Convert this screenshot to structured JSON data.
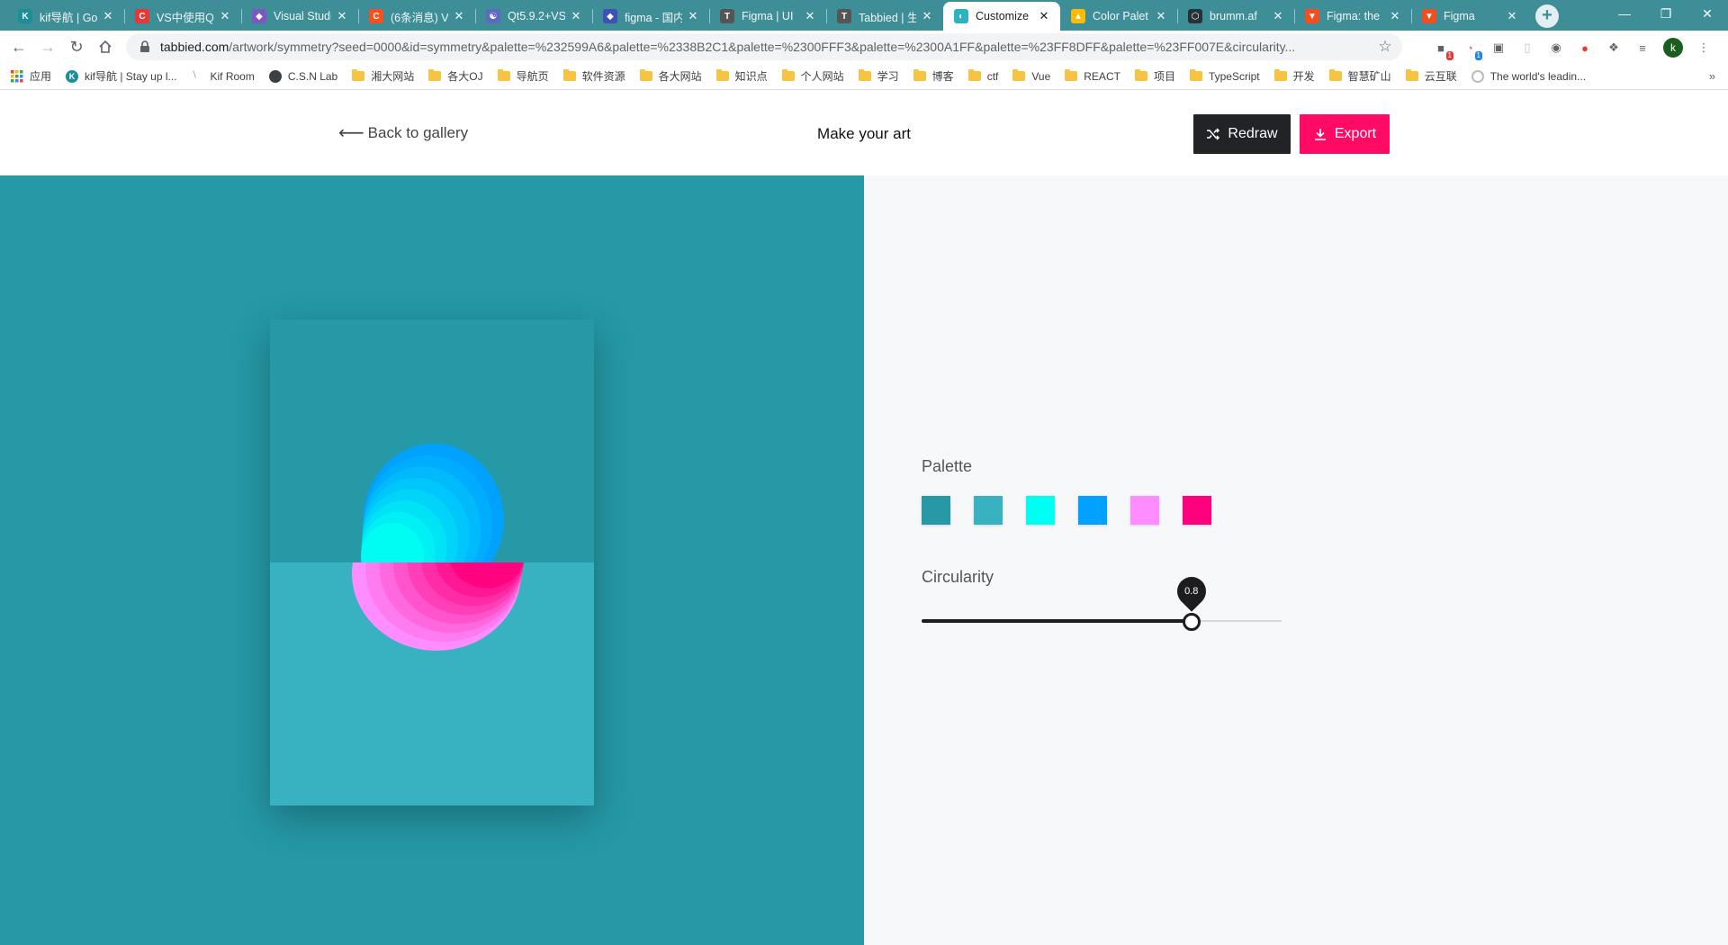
{
  "browser": {
    "tabs": [
      {
        "title": "kif导航 | Go",
        "icon_text": "K",
        "icon_color": "#1e8e96",
        "active": false
      },
      {
        "title": "VS中使用Qt",
        "icon_text": "C",
        "icon_color": "#e53935",
        "active": false
      },
      {
        "title": "Visual Studi",
        "icon_text": "◆",
        "icon_color": "#7e57c2",
        "active": false
      },
      {
        "title": "(6条消息) V",
        "icon_text": "C",
        "icon_color": "#f4511e",
        "active": false
      },
      {
        "title": "Qt5.9.2+VS",
        "icon_text": "☯",
        "icon_color": "#5c6bc0",
        "active": false
      },
      {
        "title": "figma - 国内",
        "icon_text": "◆",
        "icon_color": "#3f51b5",
        "active": false
      },
      {
        "title": "Figma | UI",
        "icon_text": "T",
        "icon_color": "#555555",
        "active": false
      },
      {
        "title": "Tabbied | 生",
        "icon_text": "T",
        "icon_color": "#555555",
        "active": false
      },
      {
        "title": "Customize",
        "icon_text": "◐",
        "icon_color": "#2bb3c0",
        "active": true
      },
      {
        "title": "Color Palet",
        "icon_text": "▲",
        "icon_color": "#fbbc04",
        "active": false
      },
      {
        "title": "brumm.af",
        "icon_text": "⬡",
        "icon_color": "#263238",
        "active": false
      },
      {
        "title": "Figma: the",
        "icon_text": "▼",
        "icon_color": "#f24e1e",
        "active": false
      },
      {
        "title": "Figma",
        "icon_text": "▼",
        "icon_color": "#f24e1e",
        "active": false
      }
    ],
    "url_host": "tabbied.com",
    "url_path": "/artwork/symmetry?seed=0000&id=symmetry&palette=%232599A6&palette=%2338B2C1&palette=%2300FFF3&palette=%2300A1FF&palette=%23FF8DFF&palette=%23FF007E&circularity...",
    "profile_initial": "k",
    "badge_1": "1",
    "badge_2": "1",
    "bookmarks": [
      {
        "label": "应用",
        "icon": "apps-icon"
      },
      {
        "label": "kif导航 | Stay up l...",
        "icon": "kif-icon"
      },
      {
        "label": "Kif Room",
        "icon": "kifroom-icon"
      },
      {
        "label": "C.S.N Lab",
        "icon": "globe-icon"
      },
      {
        "label": "湘大网站",
        "icon": "folder-icon"
      },
      {
        "label": "各大OJ",
        "icon": "folder-icon"
      },
      {
        "label": "导航页",
        "icon": "folder-icon"
      },
      {
        "label": "软件资源",
        "icon": "folder-icon"
      },
      {
        "label": "各大网站",
        "icon": "folder-icon"
      },
      {
        "label": "知识点",
        "icon": "folder-icon"
      },
      {
        "label": "个人网站",
        "icon": "folder-icon"
      },
      {
        "label": "学习",
        "icon": "folder-icon"
      },
      {
        "label": "博客",
        "icon": "folder-icon"
      },
      {
        "label": "ctf",
        "icon": "folder-icon"
      },
      {
        "label": "Vue",
        "icon": "folder-icon"
      },
      {
        "label": "REACT",
        "icon": "folder-icon"
      },
      {
        "label": "项目",
        "icon": "folder-icon"
      },
      {
        "label": "TypeScript",
        "icon": "folder-icon"
      },
      {
        "label": "开发",
        "icon": "folder-icon"
      },
      {
        "label": "智慧矿山",
        "icon": "folder-icon"
      },
      {
        "label": "云互联",
        "icon": "folder-icon"
      },
      {
        "label": "The world's leadin...",
        "icon": "github-icon"
      }
    ]
  },
  "header": {
    "back_label": "Back to gallery",
    "title": "Make your art",
    "redraw_label": "Redraw",
    "export_label": "Export"
  },
  "controls": {
    "palette_label": "Palette",
    "palette": [
      "#2599A6",
      "#38B2C1",
      "#00FFF3",
      "#00A1FF",
      "#FF8DFF",
      "#FF007E"
    ],
    "circularity_label": "Circularity",
    "circularity_value": "0.8",
    "circularity_fraction": 0.75
  },
  "artwork": {
    "background_top": "#2599A6",
    "background_bottom": "#38B2C1",
    "top_shape_colors": [
      "#00A1FF",
      "#00FFF3"
    ],
    "bottom_shape_colors": [
      "#FF8DFF",
      "#FF007E"
    ]
  }
}
